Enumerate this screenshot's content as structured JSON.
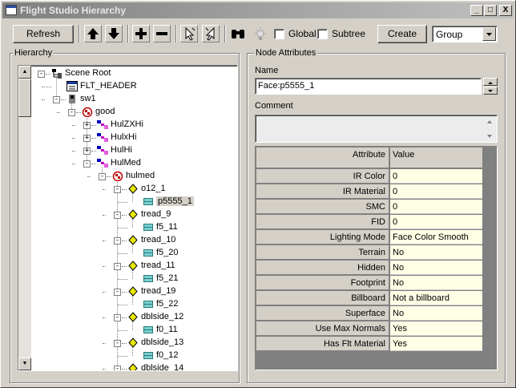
{
  "window": {
    "title": "Flight Studio Hierarchy"
  },
  "titlebar_buttons": [
    "_",
    "□",
    "X"
  ],
  "toolbar": {
    "refresh_label": "Refresh",
    "global_label": "Global",
    "subtree_label": "Subtree",
    "create_label": "Create",
    "node_type_value": "Group",
    "icons": [
      "arrow-up-icon",
      "arrow-down-icon",
      "plus-icon",
      "minus-icon",
      "cursor-select-icon",
      "cursor-select-alt-icon",
      "binoculars-icon",
      "light-icon"
    ]
  },
  "hierarchy": {
    "title": "Hierarchy",
    "nodes": [
      {
        "label": "Scene Root",
        "depth": 0,
        "expander": "-",
        "icon": "scene-root-icon"
      },
      {
        "label": "FLT_HEADER",
        "depth": 1,
        "expander": "",
        "icon": "flt-header-icon"
      },
      {
        "label": "sw1",
        "depth": 1,
        "expander": "-",
        "icon": "switch-icon"
      },
      {
        "label": "good",
        "depth": 2,
        "expander": "-",
        "icon": "group-icon"
      },
      {
        "label": "HulZXHi",
        "depth": 3,
        "expander": "+",
        "icon": "lod-icon"
      },
      {
        "label": "HulxHi",
        "depth": 3,
        "expander": "+",
        "icon": "lod-icon"
      },
      {
        "label": "HulHi",
        "depth": 3,
        "expander": "+",
        "icon": "lod-icon"
      },
      {
        "label": "HulMed",
        "depth": 3,
        "expander": "-",
        "icon": "lod-icon"
      },
      {
        "label": "hulmed",
        "depth": 4,
        "expander": "-",
        "icon": "group-icon"
      },
      {
        "label": "o12_1",
        "depth": 5,
        "expander": "-",
        "icon": "object-icon"
      },
      {
        "label": "p5555_1",
        "depth": 6,
        "expander": "",
        "icon": "face-icon",
        "selected": true
      },
      {
        "label": "tread_9",
        "depth": 5,
        "expander": "-",
        "icon": "object-icon"
      },
      {
        "label": "f5_11",
        "depth": 6,
        "expander": "",
        "icon": "face-icon"
      },
      {
        "label": "tread_10",
        "depth": 5,
        "expander": "-",
        "icon": "object-icon"
      },
      {
        "label": "f5_20",
        "depth": 6,
        "expander": "",
        "icon": "face-icon"
      },
      {
        "label": "tread_11",
        "depth": 5,
        "expander": "-",
        "icon": "object-icon"
      },
      {
        "label": "f5_21",
        "depth": 6,
        "expander": "",
        "icon": "face-icon"
      },
      {
        "label": "tread_19",
        "depth": 5,
        "expander": "-",
        "icon": "object-icon"
      },
      {
        "label": "f5_22",
        "depth": 6,
        "expander": "",
        "icon": "face-icon"
      },
      {
        "label": "dblside_12",
        "depth": 5,
        "expander": "-",
        "icon": "object-icon"
      },
      {
        "label": "f0_11",
        "depth": 6,
        "expander": "",
        "icon": "face-icon"
      },
      {
        "label": "dblside_13",
        "depth": 5,
        "expander": "-",
        "icon": "object-icon"
      },
      {
        "label": "f0_12",
        "depth": 6,
        "expander": "",
        "icon": "face-icon"
      },
      {
        "label": "dblside_14",
        "depth": 5,
        "expander": "-",
        "icon": "object-icon"
      }
    ]
  },
  "attributes": {
    "title": "Node Attributes",
    "name_label": "Name",
    "name_value": "Face:p5555_1",
    "comment_label": "Comment",
    "comment_value": "",
    "header_attribute": "Attribute",
    "header_value": "Value",
    "rows": [
      {
        "attribute": "IR Color",
        "value": "0"
      },
      {
        "attribute": "IR Material",
        "value": "0"
      },
      {
        "attribute": "SMC",
        "value": "0"
      },
      {
        "attribute": "FID",
        "value": "0"
      },
      {
        "attribute": "Lighting Mode",
        "value": "Face Color Smooth"
      },
      {
        "attribute": "Terrain",
        "value": "No"
      },
      {
        "attribute": "Hidden",
        "value": "No"
      },
      {
        "attribute": "Footprint",
        "value": "No"
      },
      {
        "attribute": "Billboard",
        "value": "Not a billboard"
      },
      {
        "attribute": "Superface",
        "value": "No"
      },
      {
        "attribute": "Use Max Normals",
        "value": "Yes"
      },
      {
        "attribute": "Has Flt Material",
        "value": "Yes"
      }
    ]
  }
}
